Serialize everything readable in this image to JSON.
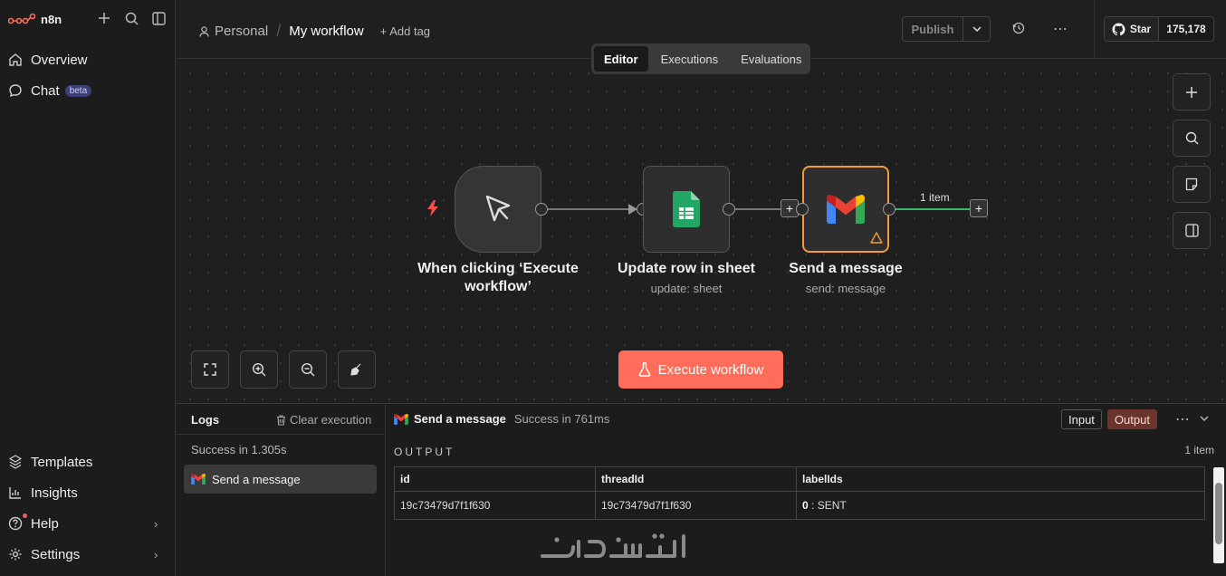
{
  "app": {
    "logo_text": "n8n"
  },
  "sidebar": {
    "nav_top": [
      {
        "label": "Overview",
        "icon": "home-icon"
      },
      {
        "label": "Chat",
        "icon": "chat-icon",
        "badge": "beta"
      }
    ],
    "nav_bottom": [
      {
        "label": "Templates",
        "icon": "templates-icon"
      },
      {
        "label": "Insights",
        "icon": "insights-icon"
      },
      {
        "label": "Help",
        "icon": "help-icon"
      },
      {
        "label": "Settings",
        "icon": "settings-icon"
      }
    ]
  },
  "header": {
    "project": "Personal",
    "workflow_name": "My workflow",
    "add_tag": "+ Add tag",
    "publish": "Publish",
    "github_star": "Star",
    "star_count": "175,178"
  },
  "tabs": [
    "Editor",
    "Executions",
    "Evaluations"
  ],
  "nodes": [
    {
      "name": "When clicking ‘Execute workflow’",
      "subtitle": ""
    },
    {
      "name": "Update row in sheet",
      "subtitle": "update: sheet"
    },
    {
      "name": "Send a message",
      "subtitle": "send: message"
    }
  ],
  "edge_label": "1 item",
  "execute_button": "Execute workflow",
  "logs": {
    "title": "Logs",
    "clear": "Clear execution",
    "summary": "Success in 1.305s",
    "entry": "Send a message",
    "node_name": "Send a message",
    "node_status": "Success in 761ms",
    "input_btn": "Input",
    "output_btn": "Output",
    "output_label": "OUTPUT",
    "item_count": "1 item",
    "columns": [
      "id",
      "threadId",
      "labelIds"
    ],
    "row": {
      "id": "19c73479d7f1f630",
      "threadId": "19c73479d7f1f630",
      "label_index": "0",
      "label_value": ": SENT"
    }
  },
  "colors": {
    "accent": "#ff6d5a",
    "selected_node_border": "#f39c37",
    "success_edge": "#3db36b"
  }
}
